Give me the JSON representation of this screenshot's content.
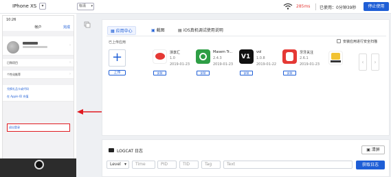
{
  "topbar": {
    "device": "IPhone XS",
    "device_caret": "▾",
    "quality": "标清",
    "quality_caret": "▾",
    "ping": "285ms",
    "used_time": "已使用：0分钟39秒",
    "stop_button": "停止使用"
  },
  "phone": {
    "time": "10:26",
    "title": "帐户",
    "close": "完成",
    "rows": [
      {
        "label": "已购项目"
      },
      {
        "label": "个性化推荐"
      },
      {
        "label": "兑换礼品卡或代码"
      },
      {
        "label": "在 Apple ID 充值"
      }
    ],
    "logout": "退出登录"
  },
  "tabs": [
    {
      "label": "应用中心"
    },
    {
      "label": "截图"
    },
    {
      "label": "iOS真机调试使用说明"
    }
  ],
  "apps": {
    "uploaded_label": "已上传应用",
    "upload_button": "上传",
    "install_security_label": "安装应用进行安全扫描",
    "items": [
      {
        "name": "浙享汇",
        "version": "1.0",
        "date": "2019-01-23",
        "install": "安装",
        "color": "#e53935"
      },
      {
        "name": "Masem Tr...",
        "version": "2.4.3",
        "date": "2019-01-23",
        "install": "安装",
        "color": "#2e9e45"
      },
      {
        "name": "vol",
        "version": "1.0.8",
        "date": "2019-01-22",
        "install": "安装",
        "color": "#111111"
      },
      {
        "name": "牙牙关注",
        "version": "2.6.1",
        "date": "2019-01-23",
        "install": "安装",
        "color": "#e53935"
      },
      {
        "name": "",
        "version": "",
        "date": "",
        "install": "",
        "color": "#f1c232"
      }
    ],
    "prev": "‹",
    "next": "›"
  },
  "logcat": {
    "title": "LOGCAT 日志",
    "clear_button": "清屏",
    "level": "Level",
    "time_ph": "Time",
    "pid_ph": "PID",
    "tid_ph": "TID",
    "tag_ph": "Tag",
    "text_ph": "Text",
    "get_button": "获取日志"
  }
}
